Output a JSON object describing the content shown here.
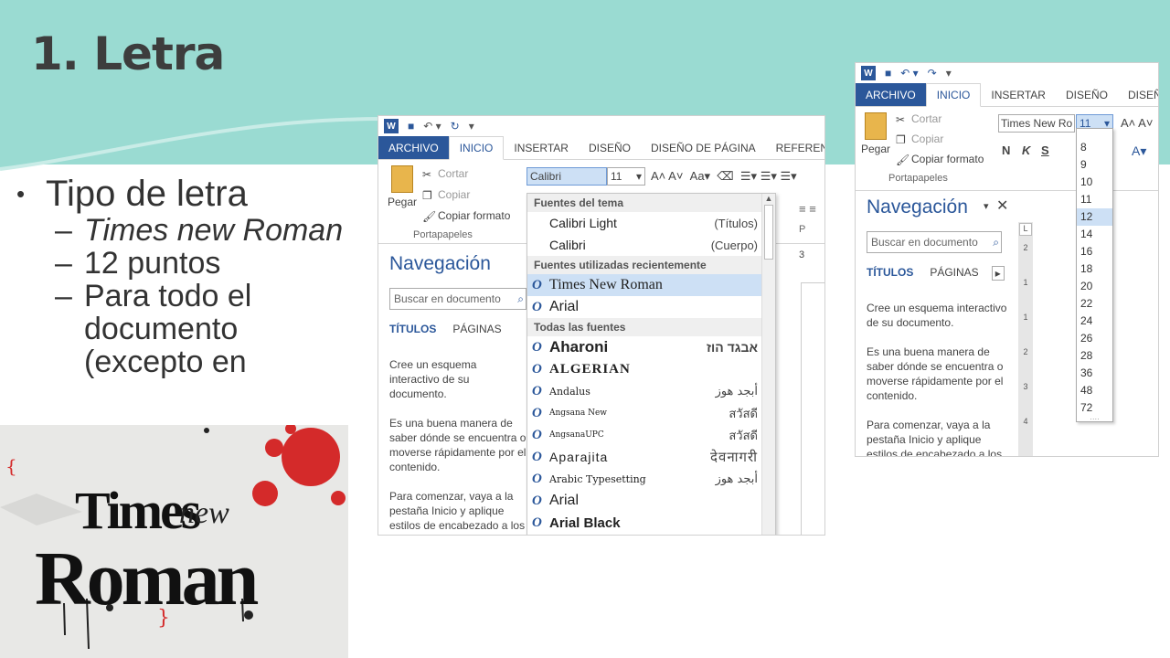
{
  "slide": {
    "title": "1. Letra",
    "bullet": "Tipo de letra",
    "subs": [
      "Times new Roman",
      "12 puntos",
      "Para todo el documento (excepto en"
    ]
  },
  "poster": {
    "word1": "Times",
    "word2": "new",
    "word3": "Roman"
  },
  "shotA": {
    "tabs": [
      "ARCHIVO",
      "INICIO",
      "INSERTAR",
      "DISEÑO",
      "DISEÑO DE PÁGINA",
      "REFERENCIAS"
    ],
    "clipboard": {
      "paste": "Pegar",
      "cut": "Cortar",
      "copy": "Copiar",
      "format": "Copiar formato",
      "group": "Portapapeles"
    },
    "font_box": "Calibri",
    "size_box": "11",
    "nav": {
      "title": "Navegación",
      "search_placeholder": "Buscar en documento",
      "tab_titles": "TÍTULOS",
      "tab_pages": "PÁGINAS",
      "p1": "Cree un esquema interactivo de su documento.",
      "p2": "Es una buena manera de saber dónde se encuentra o moverse rápidamente por el contenido.",
      "p3": "Para comenzar, vaya a la pestaña Inicio y aplique estilos de encabezado a los"
    },
    "dropdown": {
      "theme_header": "Fuentes del tema",
      "theme_fonts": [
        {
          "name": "Calibri Light",
          "role": "(Títulos)"
        },
        {
          "name": "Calibri",
          "role": "(Cuerpo)"
        }
      ],
      "recent_header": "Fuentes utilizadas recientemente",
      "recent_fonts": [
        "Times New Roman",
        "Arial"
      ],
      "all_header": "Todas las fuentes",
      "all_fonts": [
        {
          "name": "Aharoni",
          "sample": "אבגד הוז"
        },
        {
          "name": "ALGERIAN",
          "sample": ""
        },
        {
          "name": "Andalus",
          "sample": "أبجد هوز"
        },
        {
          "name": "Angsana New",
          "sample": "สวัสดี"
        },
        {
          "name": "AngsanaUPC",
          "sample": "สวัสดี"
        },
        {
          "name": "Aparajita",
          "sample": "देवनागरी"
        },
        {
          "name": "Arabic Typesetting",
          "sample": "أبجد هوز"
        },
        {
          "name": "Arial",
          "sample": ""
        },
        {
          "name": "Arial Black",
          "sample": ""
        }
      ]
    },
    "ruler_mark": "3"
  },
  "shotB": {
    "tabs": [
      "ARCHIVO",
      "INICIO",
      "INSERTAR",
      "DISEÑO",
      "DISEÑO DE"
    ],
    "clipboard": {
      "paste": "Pegar",
      "cut": "Cortar",
      "copy": "Copiar",
      "format": "Copiar formato",
      "group": "Portapapeles"
    },
    "font_box": "Times New Ro",
    "size_box": "11",
    "format_btns": [
      "N",
      "K",
      "S"
    ],
    "sizes": [
      "8",
      "9",
      "10",
      "11",
      "12",
      "14",
      "16",
      "18",
      "20",
      "22",
      "24",
      "26",
      "28",
      "36",
      "48",
      "72"
    ],
    "selected_size": "12",
    "nav": {
      "title": "Navegación",
      "search_placeholder": "Buscar en documento",
      "tab_titles": "TÍTULOS",
      "tab_pages": "PÁGINAS",
      "p1": "Cree un esquema interactivo de su documento.",
      "p2": "Es una buena manera de saber dónde se encuentra o moverse rápidamente por el contenido.",
      "p3": "Para comenzar, vaya a la pestaña Inicio y aplique estilos de encabezado a los"
    },
    "ruler_marks": [
      "2",
      "1",
      "1",
      "2",
      "3",
      "4"
    ]
  },
  "colors": {
    "band": "#9adbd2",
    "word_blue": "#2b579a",
    "poster_red": "#d42a2a"
  }
}
